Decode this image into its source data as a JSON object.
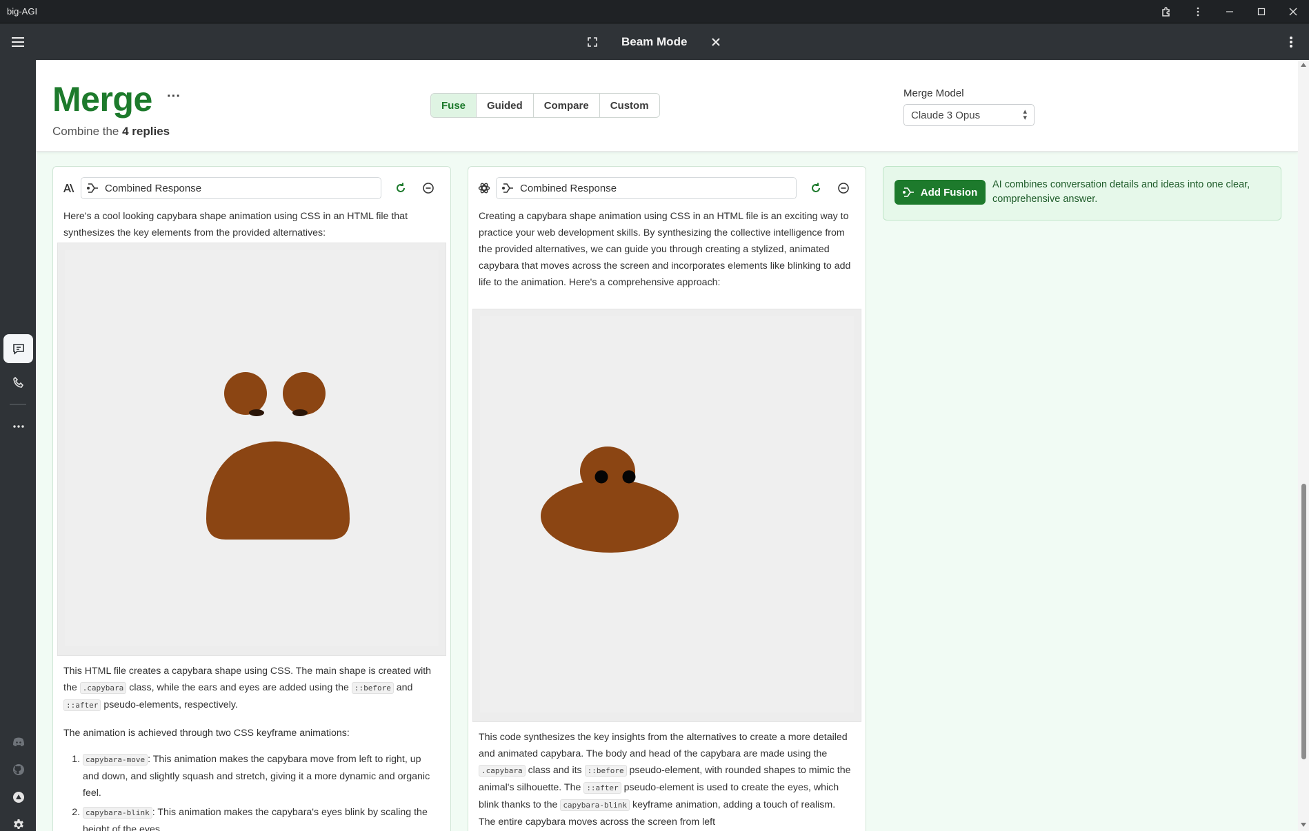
{
  "window": {
    "title": "big-AGI"
  },
  "header": {
    "title": "Beam Mode"
  },
  "merge": {
    "title": "Merge",
    "more": "···",
    "subtitle_prefix": "Combine the",
    "subtitle_count": "4 replies",
    "tabs": [
      {
        "label": "Fuse",
        "selected": true
      },
      {
        "label": "Guided"
      },
      {
        "label": "Compare"
      },
      {
        "label": "Custom"
      }
    ],
    "model_label": "Merge Model",
    "model_value": "Claude 3 Opus"
  },
  "fusion": {
    "button_label": "Add Fusion",
    "description": "AI combines conversation details and ideas into one clear, comprehensive answer."
  },
  "cards": [
    {
      "model_icon": "anthropic-icon",
      "name": "Combined Response",
      "intro": "Here's a cool looking capybara shape animation using CSS in an HTML file that synthesizes the key elements from the provided alternatives:",
      "p1_a": "This HTML file creates a capybara shape using CSS. The main shape is created with the",
      "p1_code1": ".capybara",
      "p1_b": "class, while the ears and eyes are added using the",
      "p1_code2": "::before",
      "p1_c": "and",
      "p1_code3": "::after",
      "p1_d": "pseudo-elements, respectively.",
      "p2": "The animation is achieved through two CSS keyframe animations:",
      "list": [
        {
          "code": "capybara-move",
          "text": ": This animation makes the capybara move from left to right, up and down, and slightly squash and stretch, giving it a more dynamic and organic feel."
        },
        {
          "code": "capybara-blink",
          "text": ": This animation makes the capybara's eyes blink by scaling the height of the eyes."
        }
      ]
    },
    {
      "model_icon": "openai-icon",
      "name": "Combined Response",
      "intro": "Creating a capybara shape animation using CSS in an HTML file is an exciting way to practice your web development skills. By synthesizing the collective intelligence from the provided alternatives, we can guide you through creating a stylized, animated capybara that moves across the screen and incorporates elements like blinking to add life to the animation. Here's a comprehensive approach:",
      "p1_a": "This code synthesizes the key insights from the alternatives to create a more detailed and animated capybara. The body and head of the capybara are made using the",
      "p1_code1": ".capybara",
      "p1_b": "class and its",
      "p1_code2": "::before",
      "p1_c": "pseudo-element, with rounded shapes to mimic the animal's silhouette. The",
      "p1_code3": "::after",
      "p1_d": "pseudo-element is used to create the eyes, which blink thanks to the",
      "p1_code4": "capybara-blink",
      "p1_e": "keyframe animation, adding a touch of realism. The entire capybara moves across the screen from left"
    }
  ],
  "colors": {
    "accent": "#1d7a2c",
    "capybara": "#8b4513",
    "preview_bg": "#ededed"
  }
}
